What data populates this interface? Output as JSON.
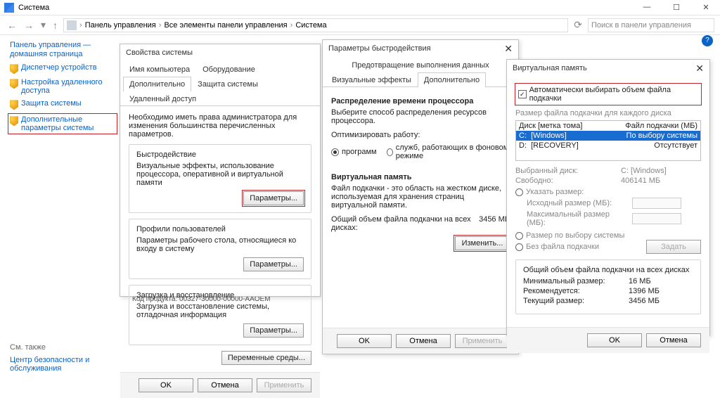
{
  "mainwin": {
    "title": "Система",
    "breadcrumbs": [
      "Панель управления",
      "Все элементы панели управления",
      "Система"
    ],
    "search_placeholder": "Поиск в панели управления",
    "sidebar": {
      "header": "Панель управления — домашняя страница",
      "items": [
        "Диспетчер устройств",
        "Настройка удаленного доступа",
        "Защита системы",
        "Дополнительные параметры системы"
      ]
    },
    "seealso_label": "См. также",
    "seealso_link": "Центр безопасности и обслуживания",
    "prodkey": "Код продукта:  00327-30000-00000-AAOEM"
  },
  "sysprops": {
    "title": "Свойства системы",
    "tabs": [
      "Имя компьютера",
      "Оборудование",
      "Дополнительно",
      "Защита системы",
      "Удаленный доступ"
    ],
    "active_tab": "Дополнительно",
    "intro": "Необходимо иметь права администратора для изменения большинства перечисленных параметров.",
    "perf": {
      "title": "Быстродействие",
      "text": "Визуальные эффекты, использование процессора, оперативной и виртуальной памяти",
      "btn": "Параметры..."
    },
    "profiles": {
      "title": "Профили пользователей",
      "text": "Параметры рабочего стола, относящиеся ко входу в систему",
      "btn": "Параметры..."
    },
    "startup": {
      "title": "Загрузка и восстановление",
      "text": "Загрузка и восстановление системы, отладочная информация",
      "btn": "Параметры..."
    },
    "envbtn": "Переменные среды...",
    "ok": "OK",
    "cancel": "Отмена",
    "apply": "Применить"
  },
  "perfopt": {
    "title": "Параметры быстродействия",
    "tabs": [
      "Визуальные эффекты",
      "Дополнительно",
      "Предотвращение выполнения данных"
    ],
    "active_tab": "Дополнительно",
    "cpu": {
      "heading": "Распределение времени процессора",
      "text": "Выберите способ распределения ресурсов процессора.",
      "optlabel": "Оптимизировать работу:",
      "opt_programs": "программ",
      "opt_services": "служб, работающих в фоновом режиме"
    },
    "vm": {
      "heading": "Виртуальная память",
      "text": "Файл подкачки - это область на жестком диске, используемая для хранения страниц виртуальной памяти.",
      "total_label": "Общий объем файла подкачки на всех дисках:",
      "total_value": "3456 МБ",
      "btn": "Изменить..."
    },
    "ok": "OK",
    "cancel": "Отмена",
    "apply": "Применить"
  },
  "vmem": {
    "title": "Виртуальная память",
    "auto_label": "Автоматически выбирать объем файла подкачки",
    "perdisk_label": "Размер файла подкачки для каждого диска",
    "col1": "Диск [метка тома]",
    "col2": "Файл подкачки (МБ)",
    "disks": [
      {
        "drive": "C:",
        "label": "[Windows]",
        "val": "По выбору системы"
      },
      {
        "drive": "D:",
        "label": "[RECOVERY]",
        "val": "Отсутствует"
      }
    ],
    "selected_drive_label": "Выбранный диск:",
    "selected_drive_value": "C:   [Windows]",
    "free_label": "Свободно:",
    "free_value": "406141 МБ",
    "custom_size": "Указать размер:",
    "initial_size": "Исходный размер (МБ):",
    "max_size": "Максимальный размер (МБ):",
    "system_managed": "Размер по выбору системы",
    "no_paging": "Без файла подкачки",
    "set_btn": "Задать",
    "summary_heading": "Общий объем файла подкачки на всех дисках",
    "rows": [
      {
        "k": "Минимальный размер:",
        "v": "16 МБ"
      },
      {
        "k": "Рекомендуется:",
        "v": "1396 МБ"
      },
      {
        "k": "Текущий размер:",
        "v": "3456 МБ"
      }
    ],
    "ok": "OK",
    "cancel": "Отмена"
  }
}
